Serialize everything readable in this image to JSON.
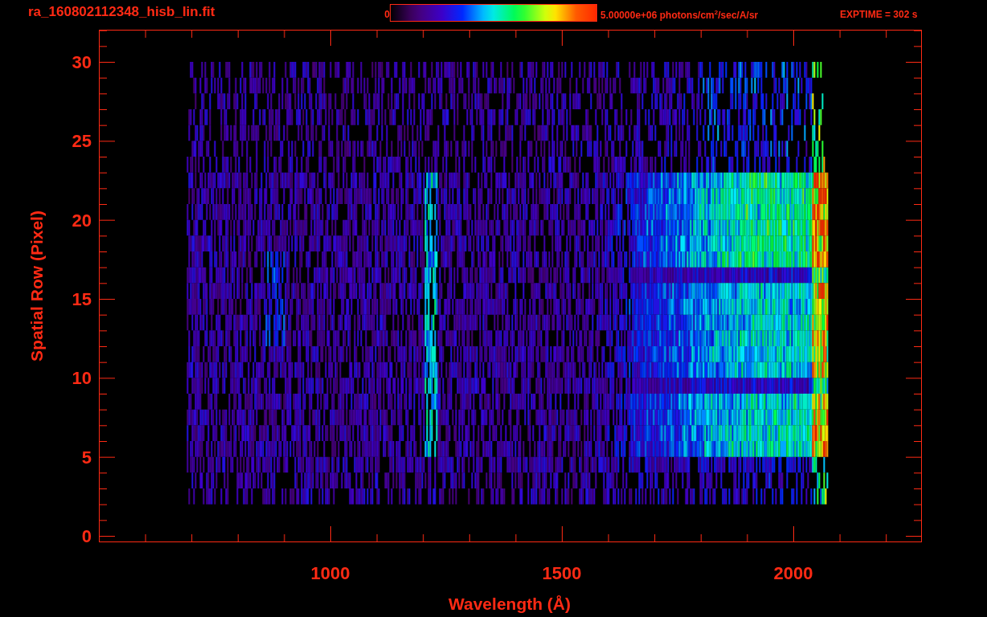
{
  "title": "ra_160802112348_hisb_lin.fit",
  "colorbar": {
    "min_label": "0",
    "max_label": "5.00000e+06 photons/cm$^{2}$/sec/A/sr"
  },
  "exposure": "EXPTIME = 302 s",
  "y_axis": {
    "label": "Spatial Row (Pixel)",
    "ticks": [
      "30",
      "25",
      "20",
      "15",
      "10",
      "5",
      "0"
    ]
  },
  "x_axis": {
    "label": "Wavelength (Å)",
    "ticks": [
      "1000",
      "1500",
      "2000"
    ]
  }
}
